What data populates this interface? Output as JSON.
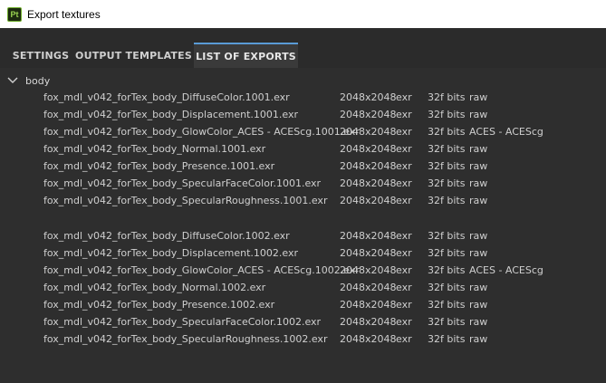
{
  "window": {
    "title": "Export textures",
    "app_icon_label": "Pt"
  },
  "tabs": [
    {
      "label": "SETTINGS"
    },
    {
      "label": "OUTPUT TEMPLATES"
    },
    {
      "label": "LIST OF EXPORTS"
    }
  ],
  "active_tab": "LIST OF EXPORTS",
  "group": {
    "label": "body",
    "expanded": true
  },
  "exports": [
    {
      "name": "fox_mdl_v042_forTex_body_DiffuseColor.1001.exr",
      "size": "2048x2048",
      "format": "exr",
      "bits": "32f bits",
      "colorspace": "raw"
    },
    {
      "name": "fox_mdl_v042_forTex_body_Displacement.1001.exr",
      "size": "2048x2048",
      "format": "exr",
      "bits": "32f bits",
      "colorspace": "raw"
    },
    {
      "name": "fox_mdl_v042_forTex_body_GlowColor_ACES - ACEScg.1001.exr",
      "size": "2048x2048",
      "format": "exr",
      "bits": "32f bits",
      "colorspace": "ACES - ACEScg"
    },
    {
      "name": "fox_mdl_v042_forTex_body_Normal.1001.exr",
      "size": "2048x2048",
      "format": "exr",
      "bits": "32f bits",
      "colorspace": "raw"
    },
    {
      "name": "fox_mdl_v042_forTex_body_Presence.1001.exr",
      "size": "2048x2048",
      "format": "exr",
      "bits": "32f bits",
      "colorspace": "raw"
    },
    {
      "name": "fox_mdl_v042_forTex_body_SpecularFaceColor.1001.exr",
      "size": "2048x2048",
      "format": "exr",
      "bits": "32f bits",
      "colorspace": "raw"
    },
    {
      "name": "fox_mdl_v042_forTex_body_SpecularRoughness.1001.exr",
      "size": "2048x2048",
      "format": "exr",
      "bits": "32f bits",
      "colorspace": "raw"
    },
    {
      "name": "fox_mdl_v042_forTex_body_DiffuseColor.1002.exr",
      "size": "2048x2048",
      "format": "exr",
      "bits": "32f bits",
      "colorspace": "raw"
    },
    {
      "name": "fox_mdl_v042_forTex_body_Displacement.1002.exr",
      "size": "2048x2048",
      "format": "exr",
      "bits": "32f bits",
      "colorspace": "raw"
    },
    {
      "name": "fox_mdl_v042_forTex_body_GlowColor_ACES - ACEScg.1002.exr",
      "size": "2048x2048",
      "format": "exr",
      "bits": "32f bits",
      "colorspace": "ACES - ACEScg"
    },
    {
      "name": "fox_mdl_v042_forTex_body_Normal.1002.exr",
      "size": "2048x2048",
      "format": "exr",
      "bits": "32f bits",
      "colorspace": "raw"
    },
    {
      "name": "fox_mdl_v042_forTex_body_Presence.1002.exr",
      "size": "2048x2048",
      "format": "exr",
      "bits": "32f bits",
      "colorspace": "raw"
    },
    {
      "name": "fox_mdl_v042_forTex_body_SpecularFaceColor.1002.exr",
      "size": "2048x2048",
      "format": "exr",
      "bits": "32f bits",
      "colorspace": "raw"
    },
    {
      "name": "fox_mdl_v042_forTex_body_SpecularRoughness.1002.exr",
      "size": "2048x2048",
      "format": "exr",
      "bits": "32f bits",
      "colorspace": "raw"
    }
  ],
  "colors": {
    "accent": "#5a9bd6",
    "app_icon": "#6fae2a",
    "background": "#2b2b2b"
  },
  "icons": {
    "app": "painter-app-icon",
    "group_toggle": "chevron-down-icon"
  }
}
